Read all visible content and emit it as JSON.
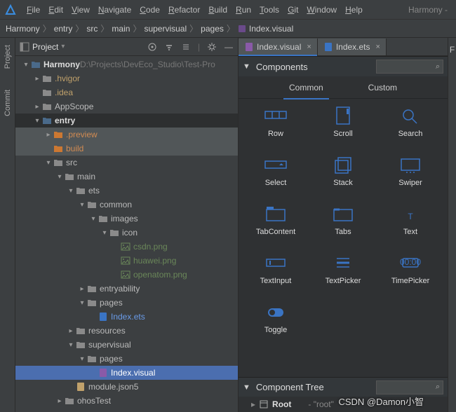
{
  "menu": {
    "items": [
      "File",
      "Edit",
      "View",
      "Navigate",
      "Code",
      "Refactor",
      "Build",
      "Run",
      "Tools",
      "Git",
      "Window",
      "Help"
    ],
    "project_name": "Harmony -"
  },
  "breadcrumb": [
    "Harmony",
    "entry",
    "src",
    "main",
    "supervisual",
    "pages",
    "Index.visual"
  ],
  "side_tabs": [
    "Project",
    "Commit"
  ],
  "project_panel": {
    "title": "Project"
  },
  "tree": [
    {
      "d": 0,
      "c": "down",
      "icon": "root",
      "label": "Harmony",
      "bold": true,
      "suffix": " D:\\Projects\\DevEco_Studio\\Test-Pro",
      "suffixClass": "dim"
    },
    {
      "d": 1,
      "c": "right",
      "icon": "folder",
      "label": ".hvigor",
      "class": "gold"
    },
    {
      "d": 1,
      "c": "none",
      "icon": "folder",
      "label": ".idea",
      "class": "gold"
    },
    {
      "d": 1,
      "c": "right",
      "icon": "folder",
      "label": "AppScope"
    },
    {
      "d": 1,
      "c": "down",
      "icon": "module",
      "label": "entry",
      "bold": true,
      "rowClass": "hover"
    },
    {
      "d": 2,
      "c": "right",
      "icon": "folder-o",
      "label": ".preview",
      "class": "orange",
      "rowClass": "sel-dark"
    },
    {
      "d": 2,
      "c": "none",
      "icon": "folder-o",
      "label": "build",
      "class": "orange",
      "rowClass": "sel-dark"
    },
    {
      "d": 2,
      "c": "down",
      "icon": "folder",
      "label": "src"
    },
    {
      "d": 3,
      "c": "down",
      "icon": "folder",
      "label": "main"
    },
    {
      "d": 4,
      "c": "down",
      "icon": "folder",
      "label": "ets"
    },
    {
      "d": 5,
      "c": "down",
      "icon": "folder",
      "label": "common"
    },
    {
      "d": 6,
      "c": "down",
      "icon": "folder",
      "label": "images"
    },
    {
      "d": 7,
      "c": "down",
      "icon": "folder",
      "label": "icon"
    },
    {
      "d": 8,
      "c": "none",
      "icon": "img",
      "label": "csdn.png",
      "class": "green"
    },
    {
      "d": 8,
      "c": "none",
      "icon": "img",
      "label": "huawei.png",
      "class": "green"
    },
    {
      "d": 8,
      "c": "none",
      "icon": "img",
      "label": "openatom.png",
      "class": "green"
    },
    {
      "d": 5,
      "c": "right",
      "icon": "folder",
      "label": "entryability"
    },
    {
      "d": 5,
      "c": "down",
      "icon": "folder",
      "label": "pages"
    },
    {
      "d": 6,
      "c": "none",
      "icon": "ets",
      "label": "Index.ets",
      "class": "blue"
    },
    {
      "d": 4,
      "c": "right",
      "icon": "folder",
      "label": "resources"
    },
    {
      "d": 4,
      "c": "down",
      "icon": "folder",
      "label": "supervisual"
    },
    {
      "d": 5,
      "c": "down",
      "icon": "folder",
      "label": "pages"
    },
    {
      "d": 6,
      "c": "none",
      "icon": "visual",
      "label": "Index.visual",
      "rowClass": "selected"
    },
    {
      "d": 4,
      "c": "none",
      "icon": "json",
      "label": "module.json5"
    },
    {
      "d": 3,
      "c": "right",
      "icon": "folder",
      "label": "ohosTest"
    }
  ],
  "editor_tabs": [
    {
      "icon": "visual",
      "label": "Index.visual",
      "active": true
    },
    {
      "icon": "ets",
      "label": "Index.ets",
      "active": false
    }
  ],
  "components": {
    "title": "Components",
    "tabs": [
      "Common",
      "Custom"
    ],
    "active_tab": 0,
    "items": [
      "Row",
      "Scroll",
      "Search",
      "Select",
      "Stack",
      "Swiper",
      "TabContent",
      "Tabs",
      "Text",
      "TextInput",
      "TextPicker",
      "TimePicker",
      "Toggle"
    ]
  },
  "component_tree": {
    "title": "Component Tree",
    "root_label": "Root",
    "root_badge": "- \"root\""
  },
  "watermark": "CSDN @Damon小智",
  "right_sliver": "F"
}
